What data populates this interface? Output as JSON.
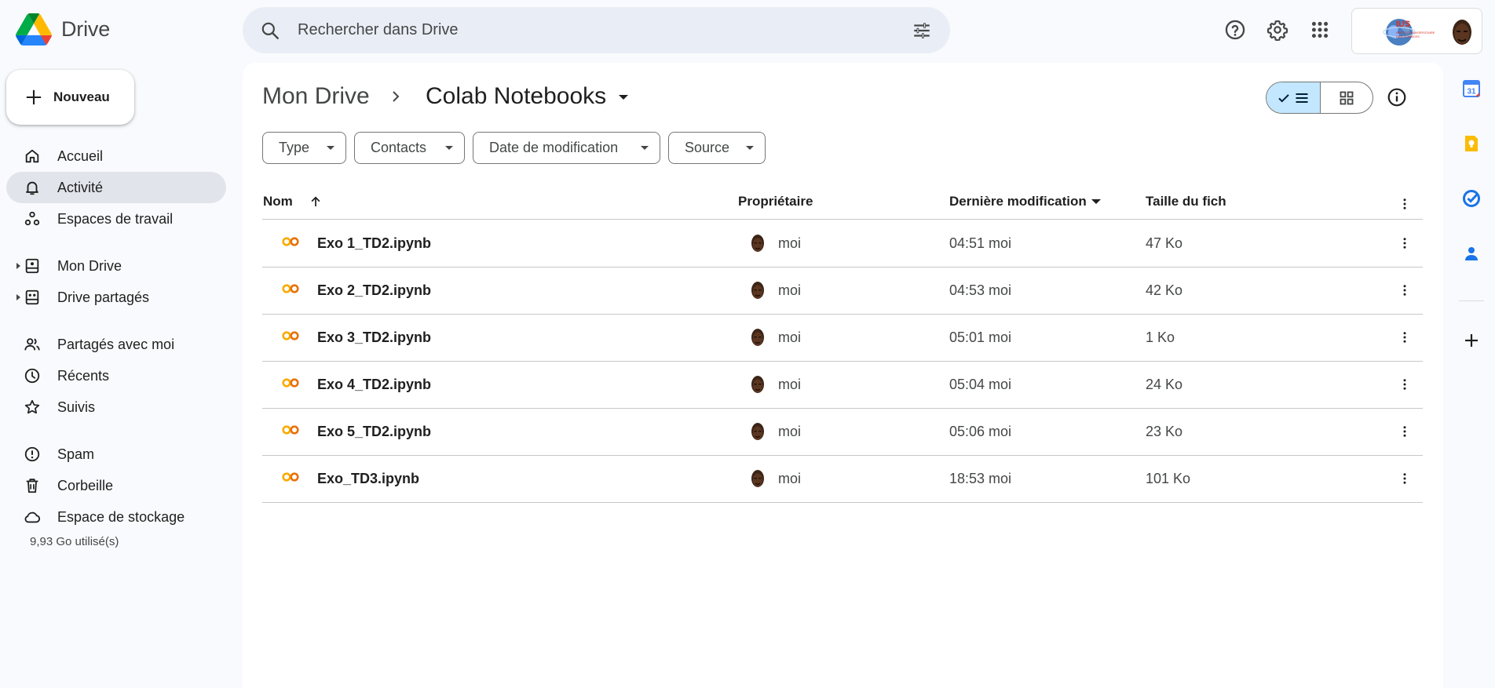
{
  "app": {
    "name": "Drive"
  },
  "search": {
    "placeholder": "Rechercher dans Drive"
  },
  "account": {
    "org_name": "IUS",
    "org_subtitle": "INSTITUT UNIVERSITAIRE DES SCIENCES"
  },
  "new_button": {
    "label": "Nouveau"
  },
  "sidebar": {
    "items": [
      {
        "label": "Accueil",
        "icon": "home-icon"
      },
      {
        "label": "Activité",
        "icon": "bell-icon",
        "active": true
      },
      {
        "label": "Espaces de travail",
        "icon": "workspaces-icon"
      },
      {
        "label": "Mon Drive",
        "icon": "my-drive-icon"
      },
      {
        "label": "Drive partagés",
        "icon": "shared-drives-icon"
      },
      {
        "label": "Partagés avec moi",
        "icon": "people-icon"
      },
      {
        "label": "Récents",
        "icon": "clock-icon"
      },
      {
        "label": "Suivis",
        "icon": "star-icon"
      },
      {
        "label": "Spam",
        "icon": "spam-icon"
      },
      {
        "label": "Corbeille",
        "icon": "trash-icon"
      },
      {
        "label": "Espace de stockage",
        "icon": "cloud-icon"
      }
    ],
    "storage_used": "9,93 Go utilisé(s)"
  },
  "breadcrumb": {
    "root": "Mon Drive",
    "current": "Colab Notebooks"
  },
  "filters": [
    {
      "label": "Type"
    },
    {
      "label": "Contacts"
    },
    {
      "label": "Date de modification"
    },
    {
      "label": "Source"
    }
  ],
  "table": {
    "columns": {
      "name": "Nom",
      "owner": "Propriétaire",
      "modified": "Dernière modification",
      "size": "Taille du fich"
    },
    "sort": {
      "column": "Nom",
      "direction": "ascending"
    },
    "rows": [
      {
        "name": "Exo 1_TD2.ipynb",
        "owner": "moi",
        "modified": "04:51 moi",
        "size": "47 Ko"
      },
      {
        "name": "Exo 2_TD2.ipynb",
        "owner": "moi",
        "modified": "04:53 moi",
        "size": "42 Ko"
      },
      {
        "name": "Exo 3_TD2.ipynb",
        "owner": "moi",
        "modified": "05:01 moi",
        "size": "1 Ko"
      },
      {
        "name": "Exo 4_TD2.ipynb",
        "owner": "moi",
        "modified": "05:04 moi",
        "size": "24 Ko"
      },
      {
        "name": "Exo 5_TD2.ipynb",
        "owner": "moi",
        "modified": "05:06 moi",
        "size": "23 Ko"
      },
      {
        "name": "Exo_TD3.ipynb",
        "owner": "moi",
        "modified": "18:53 moi",
        "size": "101 Ko"
      }
    ]
  },
  "right_rail": {
    "calendar_day": "31",
    "apps": [
      "calendar-icon",
      "keep-icon",
      "tasks-icon",
      "contacts-icon",
      "add-icon"
    ]
  },
  "colors": {
    "accent": "#0b57d0",
    "selected_view": "#c2e7ff",
    "active_nav": "#e1e4ea",
    "colab_orange": "#f9ab00"
  }
}
